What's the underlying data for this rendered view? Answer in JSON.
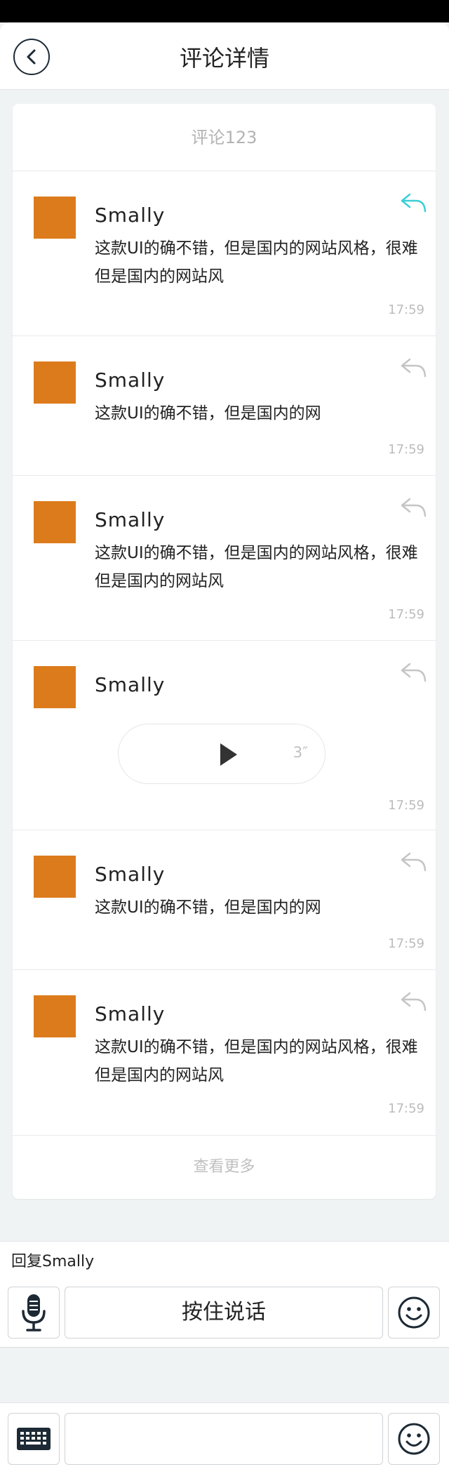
{
  "header": {
    "title": "评论详情"
  },
  "card": {
    "title": "评论123",
    "comments": [
      {
        "name": "Smally",
        "text": "这款UI的确不错，但是国内的网站风格，很难但是国内的网站风",
        "time": "17:59",
        "reply_active": true
      },
      {
        "name": "Smally",
        "text": "这款UI的确不错，但是国内的网",
        "time": "17:59",
        "reply_active": false
      },
      {
        "name": "Smally",
        "text": "这款UI的确不错，但是国内的网站风格，很难但是国内的网站风",
        "time": "17:59",
        "reply_active": false
      },
      {
        "name": "Smally",
        "voice_duration": "3″",
        "time": "17:59",
        "reply_active": false
      },
      {
        "name": "Smally",
        "text": "这款UI的确不错，但是国内的网",
        "time": "17:59",
        "reply_active": false
      },
      {
        "name": "Smally",
        "text": "这款UI的确不错，但是国内的网站风格，很难但是国内的网站风",
        "time": "17:59",
        "reply_active": false
      }
    ],
    "more_label": "查看更多"
  },
  "reply_bar": {
    "reply_to": "回复Smally",
    "talk_label": "按住说话",
    "icons": [
      "microphone-icon",
      "emoji-icon"
    ]
  },
  "input_bar": {
    "input_value": "",
    "icons": [
      "keyboard-icon",
      "emoji-icon"
    ]
  },
  "colors": {
    "avatar": "#dc7b1c",
    "reply_active": "#3ad0d6",
    "reply_inactive": "#c5c5c5",
    "muted_text": "#bcbcbc",
    "background": "#f0f3f4"
  }
}
